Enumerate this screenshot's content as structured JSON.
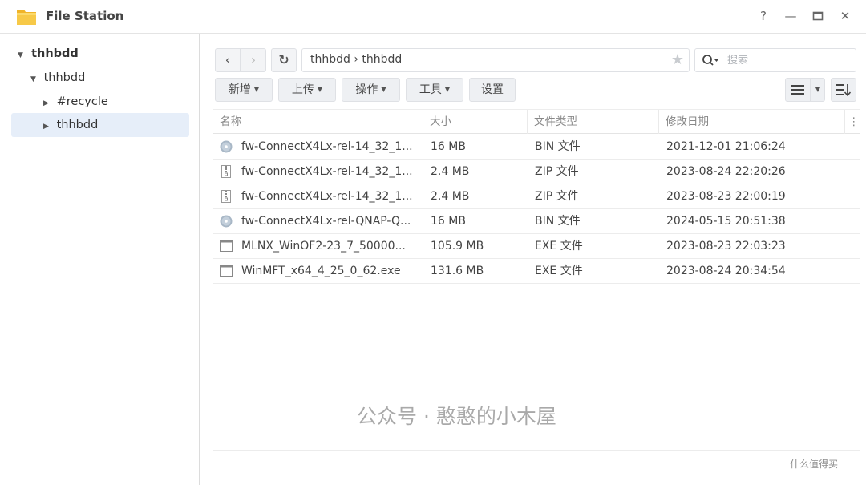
{
  "window": {
    "title": "File Station",
    "help": "?",
    "minimize": "—",
    "maximize": "▭",
    "close": "✕"
  },
  "sidebar": {
    "items": [
      {
        "label": "thhbdd",
        "arrow": "▼",
        "level": 0
      },
      {
        "label": "thhbdd",
        "arrow": "▼",
        "level": 1
      },
      {
        "label": "#recycle",
        "arrow": "▶",
        "level": 2
      },
      {
        "label": "thhbdd",
        "arrow": "▶",
        "level": 2,
        "selected": true
      }
    ]
  },
  "nav": {
    "back": "‹",
    "forward": "›",
    "refresh": "↻",
    "path": "thhbdd › thhbdd",
    "star": "★",
    "search_placeholder": "搜索"
  },
  "toolbar": {
    "new_label": "新增",
    "upload_label": "上传",
    "action_label": "操作",
    "tools_label": "工具",
    "settings_label": "设置"
  },
  "table": {
    "headers": [
      "名称",
      "大小",
      "文件类型",
      "修改日期"
    ],
    "rows": [
      {
        "name": "fw-ConnectX4Lx-rel-14_32_1...",
        "size": "16 MB",
        "type": "BIN 文件",
        "date": "2021-12-01 21:06:24",
        "icon": "disc-icon"
      },
      {
        "name": "fw-ConnectX4Lx-rel-14_32_1...",
        "size": "2.4 MB",
        "type": "ZIP 文件",
        "date": "2023-08-24 22:20:26",
        "icon": "zip-icon"
      },
      {
        "name": "fw-ConnectX4Lx-rel-14_32_1...",
        "size": "2.4 MB",
        "type": "ZIP 文件",
        "date": "2023-08-23 22:00:19",
        "icon": "zip-icon"
      },
      {
        "name": "fw-ConnectX4Lx-rel-QNAP-Q...",
        "size": "16 MB",
        "type": "BIN 文件",
        "date": "2024-05-15 20:51:38",
        "icon": "disc-icon"
      },
      {
        "name": "MLNX_WinOF2-23_7_50000...",
        "size": "105.9 MB",
        "type": "EXE 文件",
        "date": "2023-08-23 22:03:23",
        "icon": "exe-icon"
      },
      {
        "name": "WinMFT_x64_4_25_0_62.exe",
        "size": "131.6 MB",
        "type": "EXE 文件",
        "date": "2023-08-24 20:34:54",
        "icon": "exe-icon"
      }
    ]
  },
  "watermark": {
    "text": "公众号 · 憨憨的小木屋",
    "sub": "什么值得买"
  },
  "colors": {
    "selected_bg": "#e6eef9",
    "button_bg": "#eef0f3",
    "folder_yellow": "#f4c02d"
  }
}
